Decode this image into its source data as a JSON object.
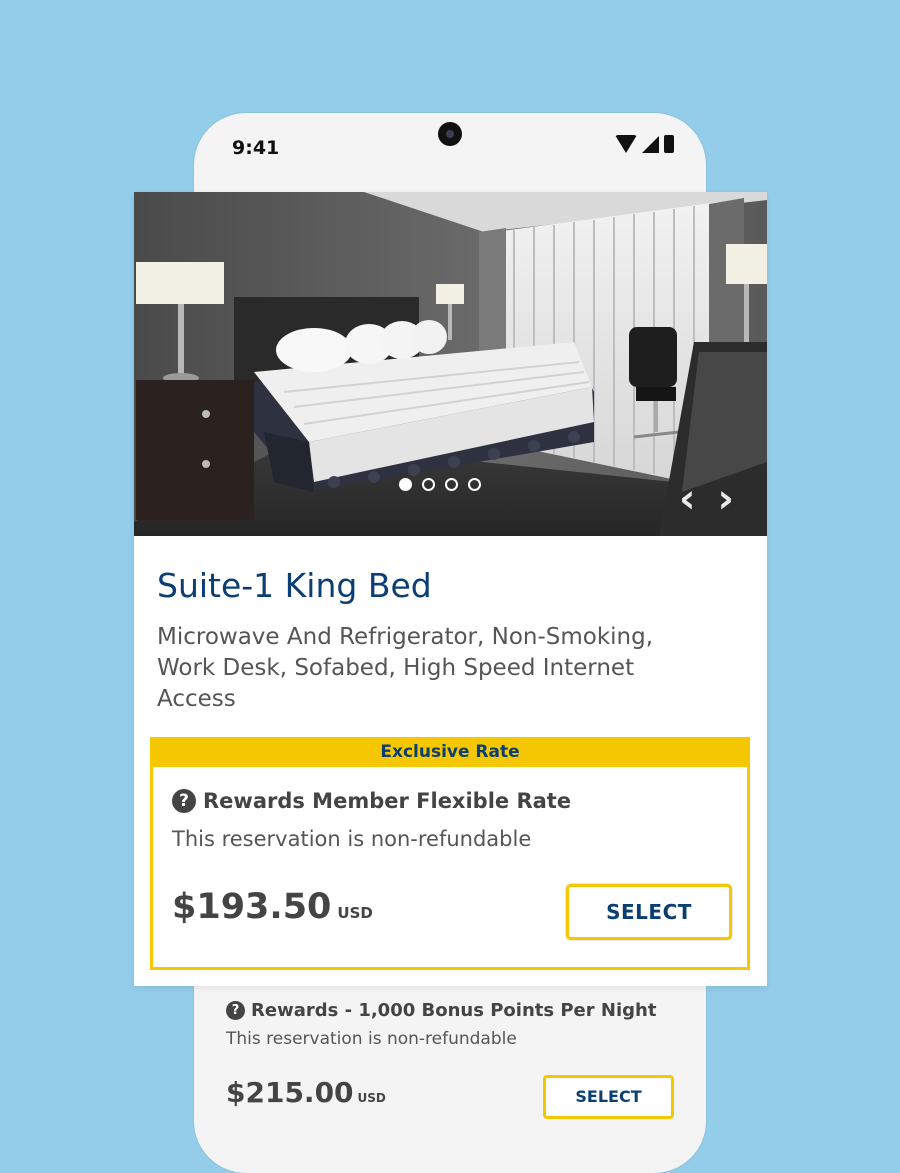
{
  "status_bar": {
    "time": "9:41"
  },
  "room": {
    "title": "Suite-1 King Bed",
    "description": "Microwave And Refrigerator, Non-Smoking, Work Desk, Sofabed, High Speed Internet Access",
    "photo_count": 4,
    "active_photo": 1
  },
  "rates": [
    {
      "banner": "Exclusive Rate",
      "name": "Rewards Member Flexible Rate",
      "note": "This reservation is non-refundable",
      "price": "$193.50",
      "currency": "USD",
      "select_label": "SELECT"
    },
    {
      "name": "Rewards - 1,000 Bonus Points Per Night",
      "note": "This reservation is non-refundable",
      "price": "$215.00",
      "currency": "USD",
      "select_label": "SELECT"
    }
  ],
  "icons": {
    "help": "?",
    "prev": "‹",
    "next": "›"
  },
  "colors": {
    "background": "#93cdea",
    "brand_blue": "#0b3f73",
    "accent_yellow": "#f5c700"
  }
}
